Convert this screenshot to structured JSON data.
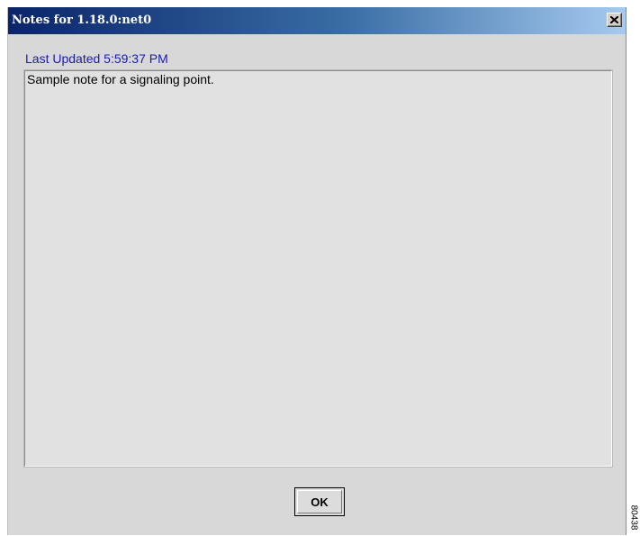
{
  "window": {
    "title": "Notes for 1.18.0:net0",
    "close_icon": "close-icon"
  },
  "last_updated": {
    "text": "Last Updated  5:59:37 PM"
  },
  "note": {
    "text": "Sample note for a signaling point."
  },
  "buttons": {
    "ok_label": "OK"
  },
  "figure_id": "80438",
  "colors": {
    "title_start": "#0a246a",
    "title_end": "#a6caf0",
    "last_updated_text": "#1a1ab4",
    "dialog_bg": "#d8d8d8"
  }
}
